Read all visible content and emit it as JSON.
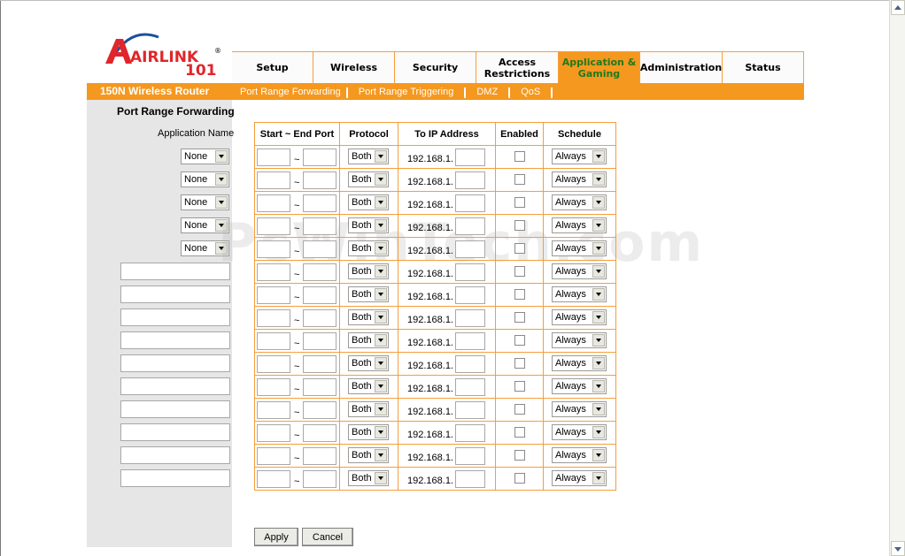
{
  "brand": {
    "logo_text": "AIRLINK",
    "logo_number": "101",
    "logo_registered": "®",
    "router_title": "150N Wireless Router"
  },
  "tabs": [
    {
      "label": "Setup"
    },
    {
      "label": "Wireless"
    },
    {
      "label": "Security"
    },
    {
      "label": "Access Restrictions",
      "line1": "Access",
      "line2": "Restrictions"
    },
    {
      "label": "Application & Gaming",
      "line1": "Application &",
      "line2": "Gaming",
      "active": true
    },
    {
      "label": "Administration"
    },
    {
      "label": "Status"
    }
  ],
  "subnav": [
    {
      "label": "Port Range Forwarding"
    },
    {
      "label": "Port Range Triggering"
    },
    {
      "label": "DMZ"
    },
    {
      "label": "QoS"
    }
  ],
  "left": {
    "section_title": "Port Range Forwarding",
    "application_name_label": "Application Name"
  },
  "table": {
    "headers": [
      "Start ~ End Port",
      "Protocol",
      "To IP Address",
      "Enabled",
      "Schedule"
    ],
    "tilde": "~",
    "ip_prefix": "192.168.1.",
    "rows": [
      {
        "app": "None",
        "protocol": "Both",
        "schedule": "Always"
      },
      {
        "app": "None",
        "protocol": "Both",
        "schedule": "Always"
      },
      {
        "app": "None",
        "protocol": "Both",
        "schedule": "Always"
      },
      {
        "app": "None",
        "protocol": "Both",
        "schedule": "Always"
      },
      {
        "app": "None",
        "protocol": "Both",
        "schedule": "Always"
      },
      {
        "app": "",
        "protocol": "Both",
        "schedule": "Always"
      },
      {
        "app": "",
        "protocol": "Both",
        "schedule": "Always"
      },
      {
        "app": "",
        "protocol": "Both",
        "schedule": "Always"
      },
      {
        "app": "",
        "protocol": "Both",
        "schedule": "Always"
      },
      {
        "app": "",
        "protocol": "Both",
        "schedule": "Always"
      },
      {
        "app": "",
        "protocol": "Both",
        "schedule": "Always"
      },
      {
        "app": "",
        "protocol": "Both",
        "schedule": "Always"
      },
      {
        "app": "",
        "protocol": "Both",
        "schedule": "Always"
      },
      {
        "app": "",
        "protocol": "Both",
        "schedule": "Always"
      },
      {
        "app": "",
        "protocol": "Both",
        "schedule": "Always"
      }
    ]
  },
  "buttons": {
    "apply": "Apply",
    "cancel": "Cancel"
  },
  "watermark": "PcWinTech.com",
  "colors": {
    "accent_orange": "#f5981f",
    "panel_gray": "#e6e6e6",
    "logo_red": "#e0262b",
    "logo_blue": "#1d4f9c",
    "active_tab_text": "#1e7a1e"
  }
}
